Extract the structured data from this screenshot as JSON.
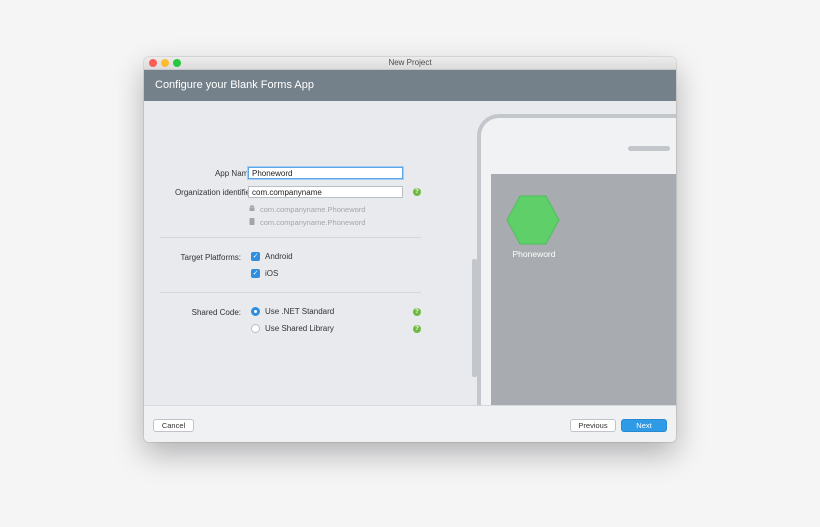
{
  "window": {
    "title": "New Project"
  },
  "header": {
    "title": "Configure your Blank Forms App"
  },
  "form": {
    "app_name_label": "App Name:",
    "app_name_value": "Phoneword",
    "org_label": "Organization identifier:",
    "org_value": "com.companyname",
    "android_id": "com.companyname.Phoneword",
    "ios_id": "com.companyname.Phoneword",
    "target_label": "Target Platforms:",
    "android_label": "Android",
    "ios_label": "iOS",
    "shared_label": "Shared Code:",
    "net_standard_label": "Use .NET Standard",
    "shared_library_label": "Use Shared Library",
    "android_checked": true,
    "ios_checked": true,
    "shared_code_selected": "Use .NET Standard"
  },
  "preview": {
    "app_name": "Phoneword"
  },
  "footer": {
    "cancel_label": "Cancel",
    "previous_label": "Previous",
    "next_label": "Next"
  },
  "icons": {
    "help": "help-icon",
    "android": "android-icon",
    "ios": "phone-icon",
    "app": "hexagon-app-icon",
    "check": "checkmark-icon"
  },
  "colors": {
    "header": "#74808a",
    "accent": "#2f8ee0",
    "help": "#6fba3f",
    "app_icon": "#5fcf6a"
  }
}
